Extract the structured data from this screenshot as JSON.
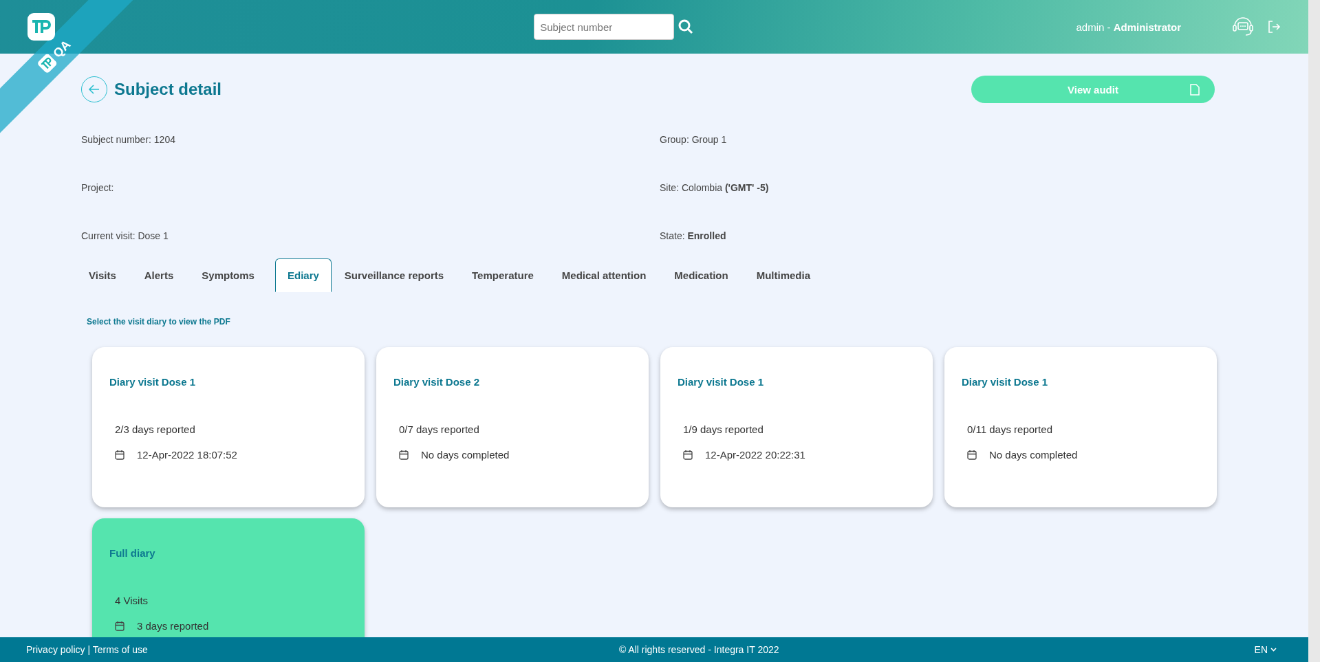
{
  "header": {
    "ribbon_label": "QA",
    "search": {
      "placeholder": "Subject number"
    },
    "user": "admin - **Administrator**"
  },
  "page": {
    "title": "Subject detail",
    "audit_button": "View audit"
  },
  "info": [
    {
      "text": "Subject number: 1204"
    },
    {
      "text": "Group: Group 1"
    },
    {
      "text": "Project:"
    },
    {
      "text": "Site: Colombia **('GMT' -5)**"
    },
    {
      "text": "Current visit: Dose 1"
    },
    {
      "text": "State: **Enrolled**"
    }
  ],
  "tabs": [
    {
      "label": "Visits",
      "selected": false
    },
    {
      "label": "Alerts",
      "selected": false
    },
    {
      "label": "Symptoms",
      "selected": false
    },
    {
      "label": "Ediary",
      "selected": true
    },
    {
      "label": "Surveillance reports",
      "selected": false
    },
    {
      "label": "Temperature",
      "selected": false
    },
    {
      "label": "Medical attention",
      "selected": false
    },
    {
      "label": "Medication",
      "selected": false
    },
    {
      "label": "Multimedia",
      "selected": false
    }
  ],
  "hint": "Select the visit diary to view the PDF",
  "cards": [
    {
      "kind": "visit",
      "title": "Diary visit Dose 1",
      "line_1": "2/3 days reported",
      "line_2": "12-Apr-2022 18:07:52"
    },
    {
      "kind": "visit",
      "title": "Diary visit Dose 2",
      "line_1": "0/7 days reported",
      "line_2": "No days completed"
    },
    {
      "kind": "visit",
      "title": "Diary visit Dose 1",
      "line_1": "1/9 days reported",
      "line_2": "12-Apr-2022 20:22:31"
    },
    {
      "kind": "visit",
      "title": "Diary visit Dose 1",
      "line_1": "0/11 days reported",
      "line_2": "No days completed"
    },
    {
      "kind": "full",
      "title": "Full diary",
      "line_1": "4 Visits",
      "line_2": "3 days reported"
    }
  ],
  "footer": {
    "links": "Privacy policy | Terms of use",
    "copyright": "© All rights reserved - Integra IT 2022",
    "language": "EN"
  }
}
